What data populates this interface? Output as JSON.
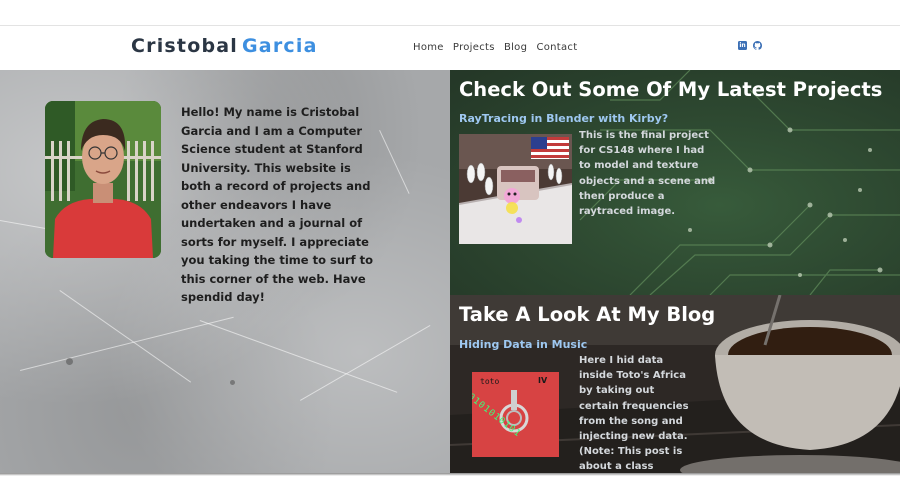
{
  "brand": {
    "first": "Cristobal",
    "last": "Garcia"
  },
  "nav": {
    "home": "Home",
    "projects": "Projects",
    "blog": "Blog",
    "contact": "Contact"
  },
  "social": {
    "linkedin": "linkedin-icon",
    "github": "github-icon"
  },
  "about": {
    "text": "Hello! My name is Cristobal Garcia and I am a Computer Science student at Stanford University. This website is both a record of projects and other endeavors I have undertaken and a journal of sorts for myself. I appreciate you taking the time to surf to this corner of the web. Have spendid day!"
  },
  "projects": {
    "title": "Check Out Some Of My Latest Projects",
    "item_title": "RayTracing in Blender with Kirby?",
    "item_desc": "This is the final project for CS148 where I had to model and texture objects and a scene and then produce a raytraced image."
  },
  "blog": {
    "title": "Take A Look At My Blog",
    "item_title": "Hiding Data in Music",
    "item_desc": "Here I hid data inside Toto's Africa by taking out certain frequencies from the song and injecting new data. (Note: This post is about a class assignment",
    "album_band": "toto",
    "album_number": "IV",
    "binary": "0101010101"
  },
  "colors": {
    "brand_accent": "#3d8fe0",
    "link_blue": "#9ec8f1",
    "nav_text": "#3a3a3a"
  }
}
